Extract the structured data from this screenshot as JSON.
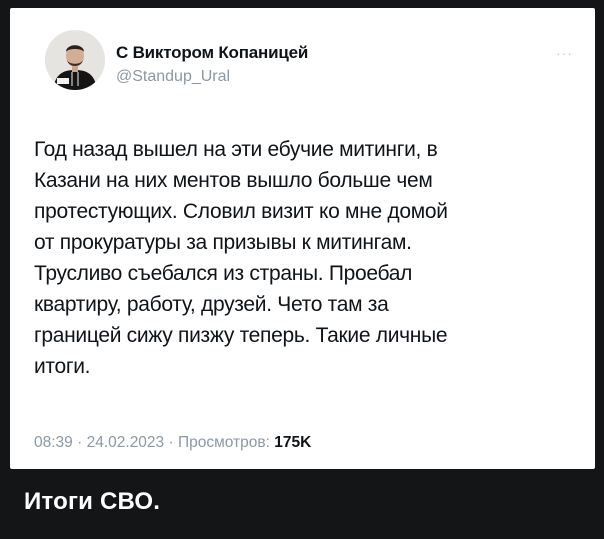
{
  "tweet": {
    "author_name": "С Виктором Копаницей",
    "author_handle": "@Standup_Ural",
    "more_icon": "more-dots-icon",
    "text": "Год назад вышел на эти ебучие митинги, в\nКазани на них ментов вышло больше чем\nпротестующих. Словил визит ко мне домой\nот прокуратуры за призывы к митингам.\nТрусливо съебался из страны. Проебал\nквартиру, работу, друзей. Чето там за\nграницей сижу пизжу теперь. Такие личные\nитоги.",
    "time": "08:39",
    "separator": "·",
    "date": "24.02.2023",
    "views_label": "Просмотров:",
    "views_count": "175K"
  },
  "caption": "Итоги СВО.",
  "colors": {
    "background": "#141517",
    "card": "#ffffff",
    "text": "#0f1419",
    "muted": "#8b98a5"
  }
}
